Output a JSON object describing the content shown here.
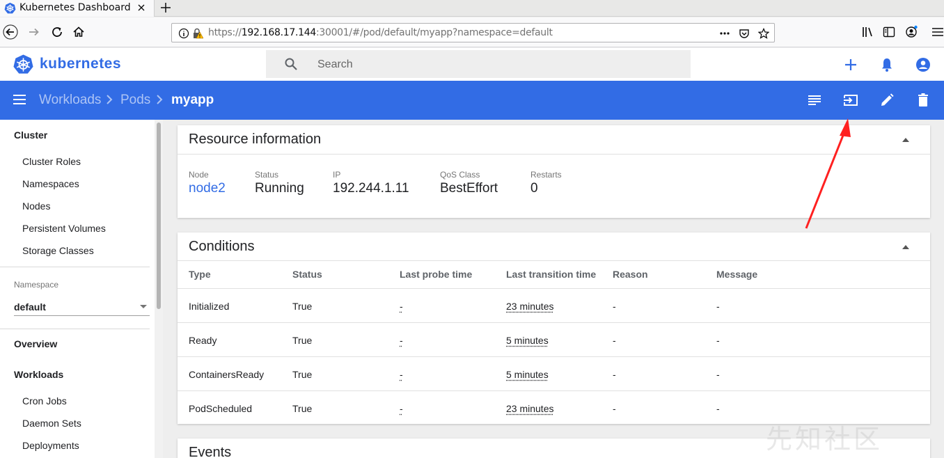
{
  "browser": {
    "tab_title": "Kubernetes Dashboard",
    "url_prefix": "https://",
    "url_host": "192.168.17.144",
    "url_rest": ":30001/#/pod/default/myapp?namespace=default"
  },
  "header": {
    "app_title": "kubernetes",
    "search_placeholder": "Search"
  },
  "toolbar": {
    "breadcrumbs": [
      "Workloads",
      "Pods",
      "myapp"
    ]
  },
  "sidebar": {
    "cluster_heading": "Cluster",
    "cluster_items": [
      "Cluster Roles",
      "Namespaces",
      "Nodes",
      "Persistent Volumes",
      "Storage Classes"
    ],
    "namespace_label": "Namespace",
    "namespace_value": "default",
    "overview": "Overview",
    "workloads_heading": "Workloads",
    "workload_items": [
      "Cron Jobs",
      "Daemon Sets",
      "Deployments"
    ]
  },
  "resource_info": {
    "title": "Resource information",
    "fields": [
      {
        "label": "Node",
        "value": "node2"
      },
      {
        "label": "Status",
        "value": "Running"
      },
      {
        "label": "IP",
        "value": "192.244.1.11"
      },
      {
        "label": "QoS Class",
        "value": "BestEffort"
      },
      {
        "label": "Restarts",
        "value": "0"
      }
    ]
  },
  "conditions": {
    "title": "Conditions",
    "columns": [
      "Type",
      "Status",
      "Last probe time",
      "Last transition time",
      "Reason",
      "Message"
    ],
    "rows": [
      [
        "Initialized",
        "True",
        "-",
        "23 minutes",
        "-",
        "-"
      ],
      [
        "Ready",
        "True",
        "-",
        "5 minutes",
        "-",
        "-"
      ],
      [
        "ContainersReady",
        "True",
        "-",
        "5 minutes",
        "-",
        "-"
      ],
      [
        "PodScheduled",
        "True",
        "-",
        "23 minutes",
        "-",
        "-"
      ]
    ]
  },
  "events": {
    "title": "Events"
  },
  "watermark": "先知社区",
  "colors": {
    "brand": "#326ce5",
    "annotation_arrow": "#ff2020"
  }
}
